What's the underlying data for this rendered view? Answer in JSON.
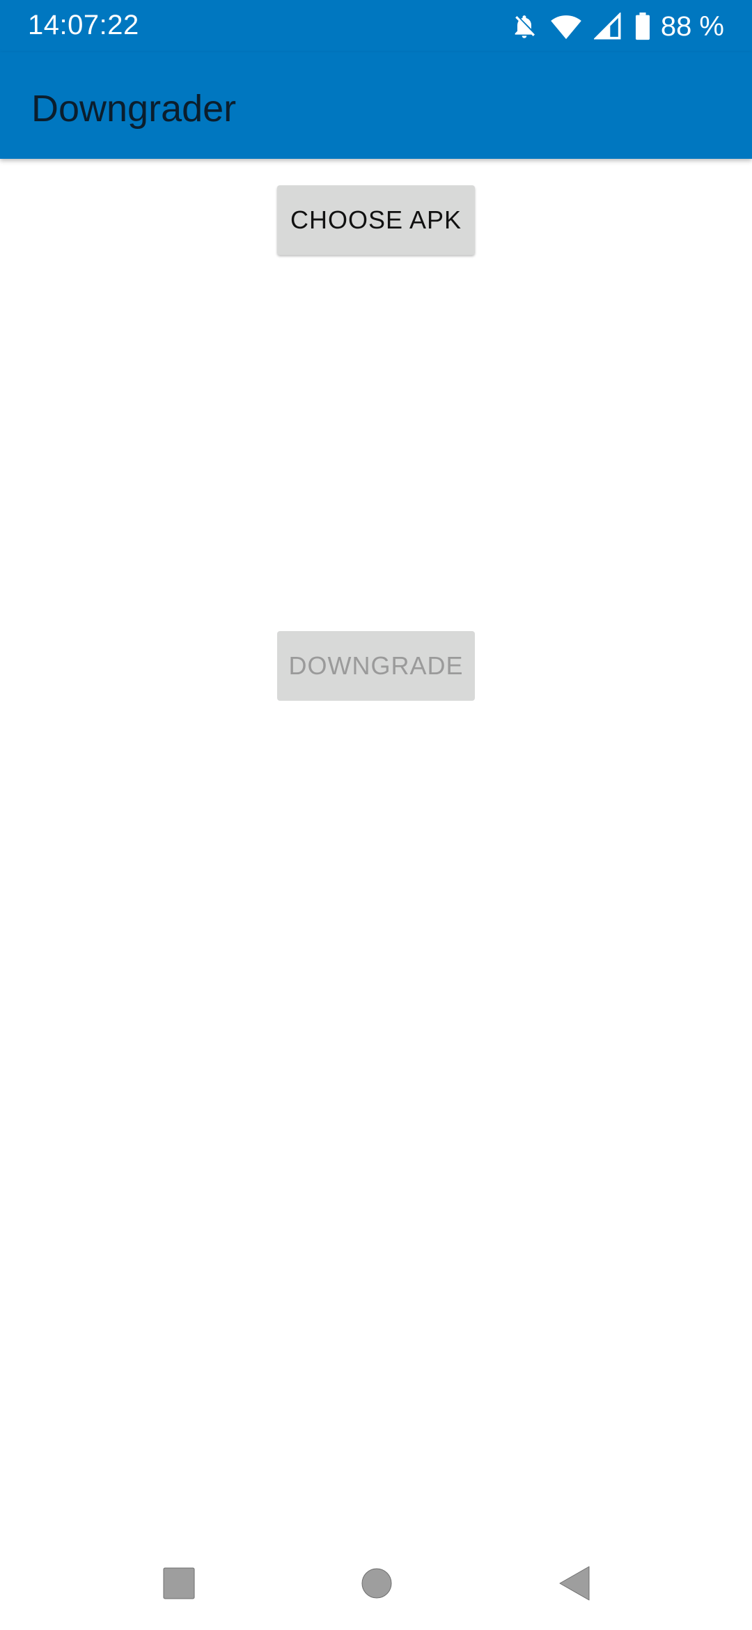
{
  "status_bar": {
    "time": "14:07:22",
    "battery_percent": "88 %",
    "icons": [
      "notifications-off-icon",
      "wifi-icon",
      "signal-icon",
      "battery-icon"
    ]
  },
  "app_bar": {
    "title": "Downgrader"
  },
  "buttons": {
    "choose_apk": "CHOOSE APK",
    "downgrade": "DOWNGRADE"
  },
  "navigation": {
    "icons": [
      "recents-icon",
      "home-icon",
      "back-icon"
    ]
  },
  "colors": {
    "primary": "#0077c0",
    "title_text": "#0b1e2d",
    "button_bg": "#d8d9d8",
    "button_disabled_text": "#9a9a9a",
    "nav_icon": "#9e9e9e"
  }
}
